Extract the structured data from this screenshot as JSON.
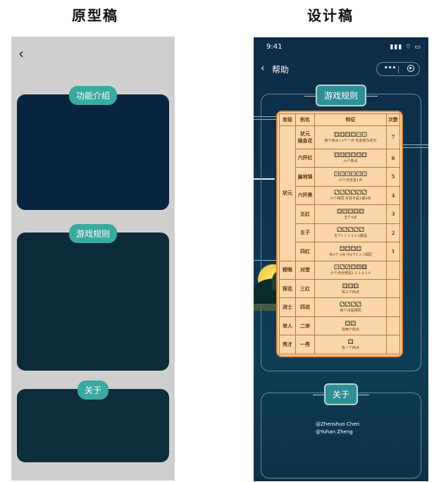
{
  "headings": {
    "prototype": "原型稿",
    "design": "设计稿"
  },
  "prototype": {
    "back_icon": "‹",
    "sections": [
      {
        "label": "功能介绍"
      },
      {
        "label": "游戏规则"
      },
      {
        "label": "关于"
      }
    ]
  },
  "design": {
    "status_time": "9:41",
    "status_icons": "▮▮▮ ⌔ ▭",
    "nav": {
      "back_icon": "‹",
      "title": "帮助",
      "more_icon": "•••"
    },
    "rules_title": "游戏规则",
    "table": {
      "headers": [
        "官级",
        "别名",
        "特征",
        "次数"
      ],
      "groups": [
        {
          "rank": "状元",
          "rows": [
            {
              "name": "状元\n插金花",
              "dice": "⚃⚃⚃⚃⚀⚀",
              "note": "四个四点+2个一点 有此者为状元",
              "count": "7"
            },
            {
              "name": "六抔红",
              "dice": "⚃⚃⚃⚃⚃⚃",
              "note": "六个四点",
              "count": "6"
            },
            {
              "name": "遍地锦",
              "dice": "⚀⚀⚀⚀⚀⚀",
              "note": "六个点全是1点",
              "count": "5"
            },
            {
              "name": "六抔黑",
              "dice": "⚁⚁⚁⚁⚁⚁",
              "note": "六个相同 并且不是1或4点",
              "count": "4"
            },
            {
              "name": "五红",
              "dice": "⚃⚃⚃⚃⚃",
              "note": "五个4点",
              "count": "3"
            },
            {
              "name": "五子",
              "dice": "⚁⚁⚁⚁⚁",
              "note": "五个1 2 3 4 5 6都是",
              "count": "2"
            },
            {
              "name": "四红",
              "dice": "⚃⚃⚃⚃",
              "note": "有4个 4点 与4个1 2 3相同",
              "count": "1"
            }
          ]
        },
        {
          "rank": "榜眼",
          "rows": [
            {
              "name": "对堂",
              "dice": "⚀⚁⚂⚃⚄⚅",
              "note": "六个点全部是1 2 3 4 5 6",
              "count": ""
            }
          ]
        },
        {
          "rank": "探花",
          "rows": [
            {
              "name": "三红",
              "dice": "⚃⚃⚃",
              "note": "有三个四点",
              "count": ""
            }
          ]
        },
        {
          "rank": "进士",
          "rows": [
            {
              "name": "四进",
              "dice": "⚁⚁⚁⚁",
              "note": "四个点是相同",
              "count": ""
            }
          ]
        },
        {
          "rank": "举人",
          "rows": [
            {
              "name": "二举",
              "dice": "⚃⚃",
              "note": "有两个四点",
              "count": ""
            }
          ]
        },
        {
          "rank": "秀才",
          "rows": [
            {
              "name": "一秀",
              "dice": "⚃",
              "note": "有一个四点",
              "count": ""
            }
          ]
        }
      ]
    },
    "about_title": "关于",
    "credits": [
      "@Zhenshuo Chen",
      "@Yuhan Zheng"
    ]
  }
}
